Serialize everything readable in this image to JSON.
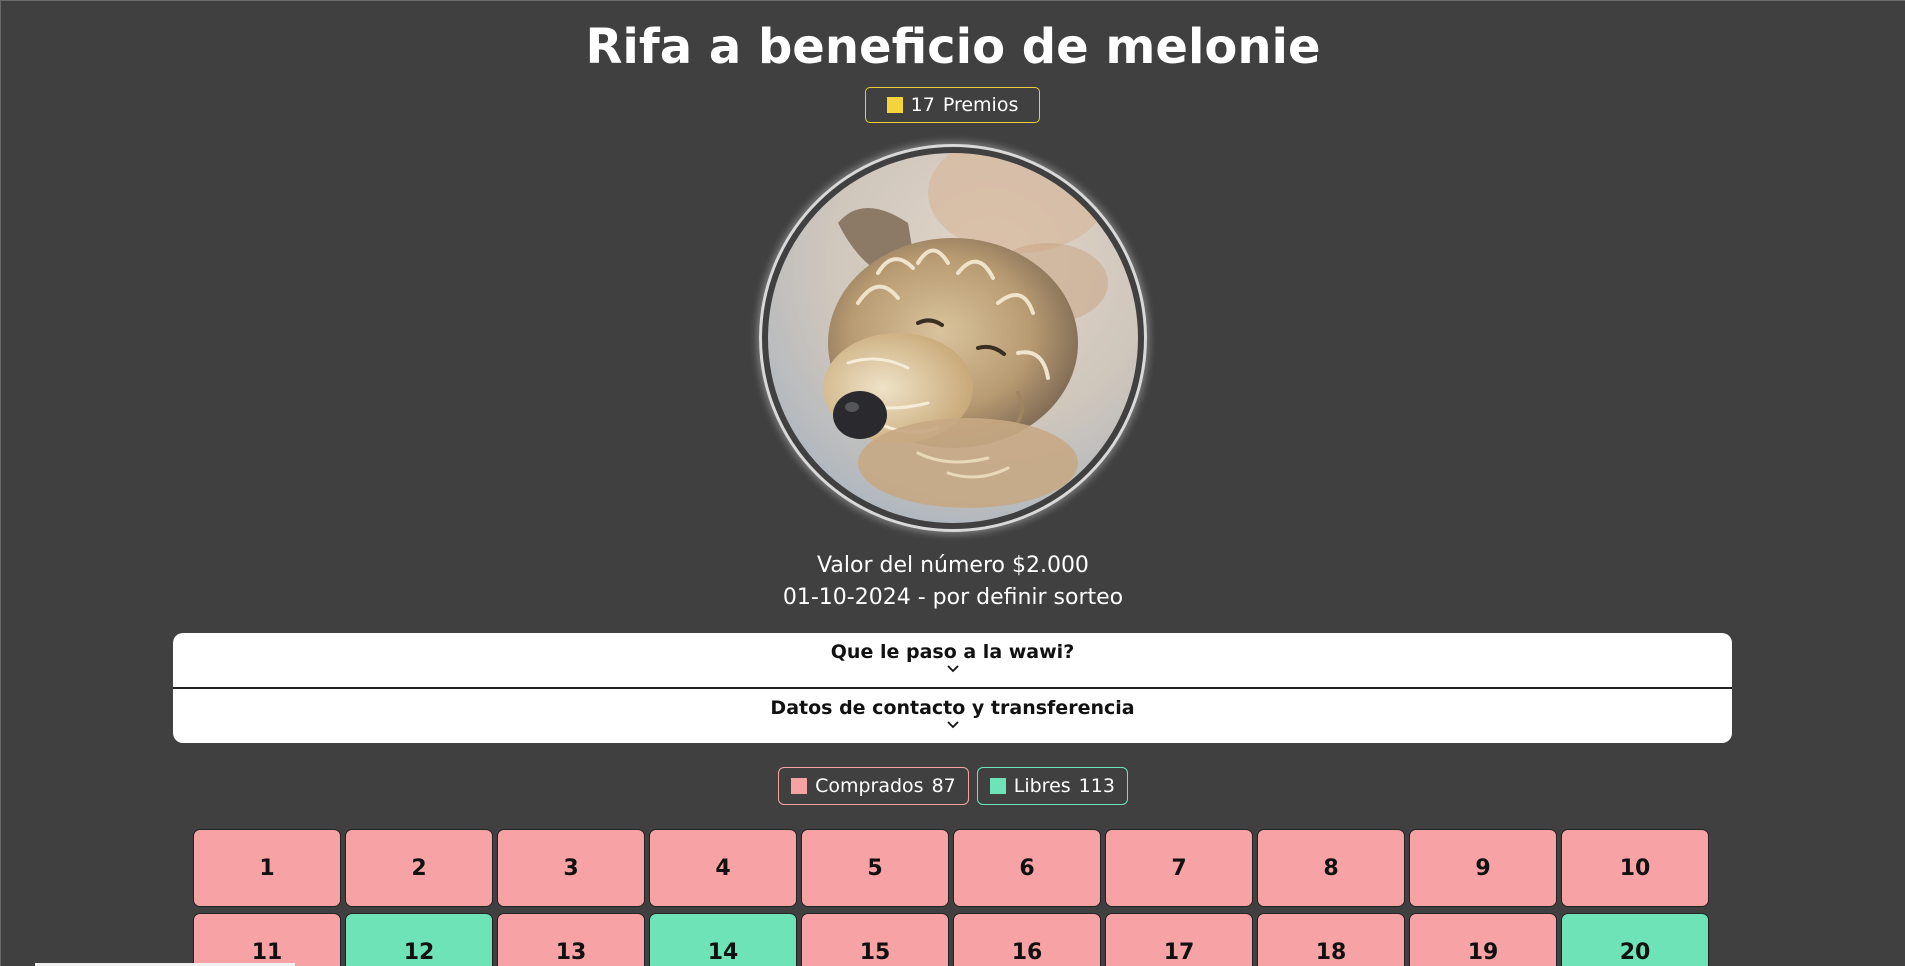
{
  "title": "Rifa a beneficio de melonie",
  "prizes": {
    "count": "17",
    "label": "Premios",
    "color": "#f5d33a",
    "border_color": "#e8cd3a"
  },
  "avatar": {
    "subject": "dog-photo"
  },
  "price_text": "Valor del número $2.000",
  "date_text": "01-10-2024 - por definir sorteo",
  "accordion": [
    {
      "title": "Que le paso a la wawi?",
      "icon": "chevron-down-icon"
    },
    {
      "title": "Datos de contacto y transferencia",
      "icon": "chevron-down-icon"
    }
  ],
  "legend": {
    "bought": {
      "label": "Comprados",
      "count": "87",
      "color": "#f7a3a6"
    },
    "free": {
      "label": "Libres",
      "count": "113",
      "color": "#6ee3b7"
    }
  },
  "numbers": [
    {
      "n": "1",
      "status": "bought"
    },
    {
      "n": "2",
      "status": "bought"
    },
    {
      "n": "3",
      "status": "bought"
    },
    {
      "n": "4",
      "status": "bought"
    },
    {
      "n": "5",
      "status": "bought"
    },
    {
      "n": "6",
      "status": "bought"
    },
    {
      "n": "7",
      "status": "bought"
    },
    {
      "n": "8",
      "status": "bought"
    },
    {
      "n": "9",
      "status": "bought"
    },
    {
      "n": "10",
      "status": "bought"
    },
    {
      "n": "11",
      "status": "bought"
    },
    {
      "n": "12",
      "status": "free"
    },
    {
      "n": "13",
      "status": "bought"
    },
    {
      "n": "14",
      "status": "free"
    },
    {
      "n": "15",
      "status": "bought"
    },
    {
      "n": "16",
      "status": "bought"
    },
    {
      "n": "17",
      "status": "bought"
    },
    {
      "n": "18",
      "status": "bought"
    },
    {
      "n": "19",
      "status": "bought"
    },
    {
      "n": "20",
      "status": "free"
    }
  ],
  "colors": {
    "background": "#404040",
    "bought": "#f7a3a6",
    "free": "#6ee3b7",
    "accent": "#f5d33a"
  }
}
